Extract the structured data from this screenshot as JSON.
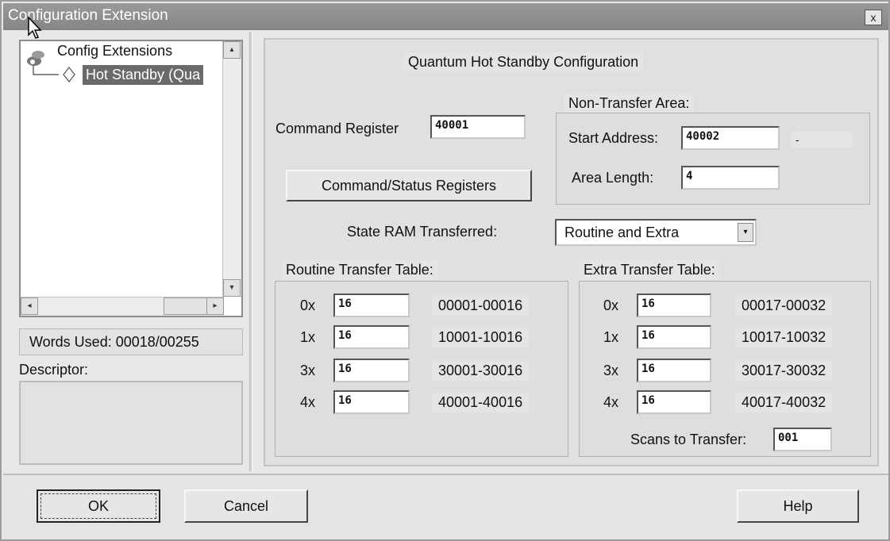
{
  "window": {
    "title": "Configuration Extension",
    "close_label": "x"
  },
  "tree": {
    "root_label": "Config Extensions",
    "child_label": "Hot Standby (Qua"
  },
  "sidebar": {
    "words_used": "Words Used: 00018/00255",
    "descriptor_label": "Descriptor:"
  },
  "main": {
    "heading": "Quantum Hot Standby Configuration",
    "command_register_label": "Command Register",
    "command_register_value": "40001",
    "cmd_status_button": "Command/Status Registers",
    "non_transfer": {
      "title": "Non-Transfer Area:",
      "start_label": "Start Address:",
      "start_value": "40002",
      "start_suffix": "-",
      "length_label": "Area Length:",
      "length_value": "4"
    },
    "state_ram_label": "State RAM Transferred:",
    "state_ram_value": "Routine and Extra",
    "routine": {
      "title": "Routine Transfer Table:",
      "rows": [
        {
          "type": "0x",
          "value": "16",
          "range": "00001-00016"
        },
        {
          "type": "1x",
          "value": "16",
          "range": "10001-10016"
        },
        {
          "type": "3x",
          "value": "16",
          "range": "30001-30016"
        },
        {
          "type": "4x",
          "value": "16",
          "range": "40001-40016"
        }
      ]
    },
    "extra": {
      "title": "Extra Transfer Table:",
      "rows": [
        {
          "type": "0x",
          "value": "16",
          "range": "00017-00032"
        },
        {
          "type": "1x",
          "value": "16",
          "range": "10017-10032"
        },
        {
          "type": "3x",
          "value": "16",
          "range": "30017-30032"
        },
        {
          "type": "4x",
          "value": "16",
          "range": "40017-40032"
        }
      ],
      "scans_label": "Scans to Transfer:",
      "scans_value": "001"
    }
  },
  "footer": {
    "ok": "OK",
    "cancel": "Cancel",
    "help": "Help"
  }
}
